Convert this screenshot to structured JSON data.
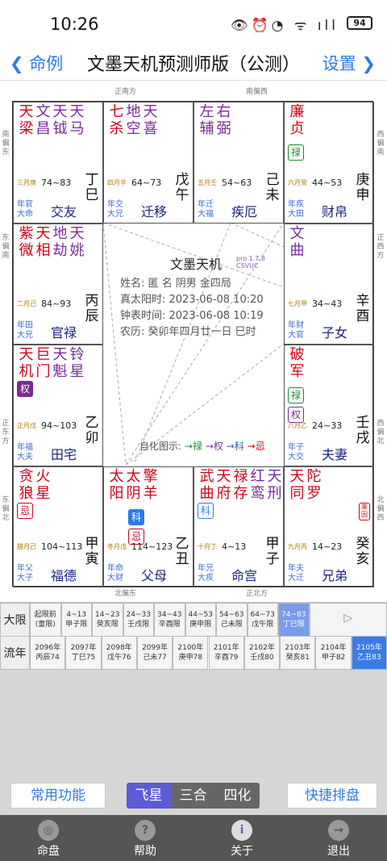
{
  "status": {
    "time": "10:26",
    "battery": "94"
  },
  "nav": {
    "back": "命例",
    "title": "文墨天机预测师版（公测）",
    "settings": "设置"
  },
  "directions": {
    "top_left": "正南方",
    "top_right": "南偏西",
    "left_top": "南偏东",
    "left_mid": "东偏南",
    "left_low": "正东方",
    "left_bottom": "东偏北",
    "right_top": "西偏南",
    "right_mid": "正西方",
    "right_low": "西偏北",
    "right_bottom": "北偏西",
    "bottom_left": "北偏东",
    "bottom_right": "正北方"
  },
  "palaces": [
    {
      "id": "si",
      "stars": [
        "天梁",
        "文昌",
        "天钺",
        "天马"
      ],
      "colors": [
        "red",
        "purple",
        "purple",
        "purple"
      ],
      "sihua": "",
      "changsheng": "三月庚",
      "age": "74~83",
      "ganzhi": "丁巳",
      "liunian": "年官",
      "daxian": "大命",
      "name": "交友"
    },
    {
      "id": "wu",
      "stars": [
        "七杀",
        "地空",
        "天喜"
      ],
      "colors": [
        "red",
        "purple",
        "purple"
      ],
      "sihua": "",
      "changsheng": "四月辛",
      "age": "64~73",
      "ganzhi": "戊午",
      "liunian": "年交",
      "daxian": "大兄",
      "name": "迁移"
    },
    {
      "id": "wei",
      "stars": [
        "左辅",
        "右弼"
      ],
      "colors": [
        "purple",
        "purple"
      ],
      "sihua": "",
      "changsheng": "五月壬",
      "age": "54~63",
      "ganzhi": "己未",
      "liunian": "年迁",
      "daxian": "大福",
      "name": "疾厄"
    },
    {
      "id": "shen",
      "stars": [
        "廉贞"
      ],
      "colors": [
        "red"
      ],
      "sihua": "禄",
      "changsheng": "六月癸",
      "age": "44~53",
      "ganzhi": "庚申",
      "liunian": "年疾",
      "daxian": "大田",
      "name": "财帛"
    },
    {
      "id": "chen",
      "stars": [
        "紫微",
        "天相",
        "地劫",
        "天姚"
      ],
      "colors": [
        "red",
        "red",
        "purple",
        "purple"
      ],
      "sihua": "",
      "changsheng": "二月己",
      "age": "84~93",
      "ganzhi": "丙辰",
      "liunian": "年田",
      "daxian": "大兄",
      "name": "官禄"
    },
    {
      "id": "you",
      "stars": [
        "文曲"
      ],
      "colors": [
        "purple"
      ],
      "sihua": "",
      "changsheng": "七月甲",
      "age": "34~43",
      "ganzhi": "辛酉",
      "liunian": "年财",
      "daxian": "大官",
      "name": "子女"
    },
    {
      "id": "mao",
      "stars": [
        "天机",
        "巨门",
        "天魁",
        "铃星"
      ],
      "colors": [
        "red",
        "red",
        "purple",
        "purple"
      ],
      "sihua": "权",
      "changsheng": "正月戊",
      "age": "94~103",
      "ganzhi": "乙卯",
      "liunian": "年福",
      "daxian": "大夫",
      "name": "田宅"
    },
    {
      "id": "xu",
      "stars": [
        "破军"
      ],
      "colors": [
        "red"
      ],
      "sihua": "禄权",
      "changsheng": "八月乙",
      "age": "24~33",
      "ganzhi": "壬戌",
      "liunian": "年子",
      "daxian": "大交",
      "name": "夫妻"
    },
    {
      "id": "yin",
      "stars": [
        "贪狼",
        "火星"
      ],
      "colors": [
        "red",
        "red"
      ],
      "sihua": "忌",
      "changsheng": "腊月己",
      "age": "104~113",
      "ganzhi": "甲寅",
      "liunian": "年父",
      "daxian": "大子",
      "name": "福德"
    },
    {
      "id": "chou",
      "stars": [
        "太阳",
        "太阴",
        "擎羊"
      ],
      "colors": [
        "red",
        "red",
        "red"
      ],
      "sihua": "科忌",
      "changsheng": "冬月戊",
      "age": "114~123",
      "ganzhi": "乙丑",
      "liunian": "年命",
      "daxian": "大财",
      "name": "父母"
    },
    {
      "id": "zi",
      "stars": [
        "武曲",
        "天府",
        "禄存",
        "红鸾",
        "天刑"
      ],
      "colors": [
        "red",
        "red",
        "red",
        "purple",
        "purple"
      ],
      "sihua": "科",
      "changsheng": "十月丁",
      "age": "4~13",
      "ganzhi": "甲子",
      "liunian": "年兄",
      "daxian": "大疾",
      "name": "命宫"
    },
    {
      "id": "hai",
      "stars": [
        "天同",
        "陀罗"
      ],
      "colors": [
        "red",
        "red"
      ],
      "sihua": "来因",
      "changsheng": "九月丙",
      "age": "14~23",
      "ganzhi": "癸亥",
      "liunian": "年夫",
      "daxian": "大迁",
      "name": "兄弟"
    }
  ],
  "center": {
    "title": "文墨天机",
    "version": "pro 1.7.8",
    "version_code": "C5VUC",
    "name_line": "姓名: 匿 名          阴男 金四局",
    "solar_line": "真太阳时: 2023-06-08 10:20",
    "clock_line": "钟表时间: 2023-06-08 10:19",
    "lunar_line": "农历: 癸卯年四月廿一日 巳时",
    "legend_label": "自化图示:",
    "legend_items": [
      "→禄",
      "→权",
      "→科",
      "→忌"
    ]
  },
  "daxian_label": "大限",
  "daxian": [
    {
      "top": "起限前",
      "bot": "(童限)"
    },
    {
      "top": "4~13",
      "bot": "甲子限"
    },
    {
      "top": "14~23",
      "bot": "癸亥限"
    },
    {
      "top": "24~33",
      "bot": "壬戌限"
    },
    {
      "top": "34~43",
      "bot": "辛酉限"
    },
    {
      "top": "44~53",
      "bot": "庚申限"
    },
    {
      "top": "54~63",
      "bot": "己未限"
    },
    {
      "top": "64~73",
      "bot": "戊午限"
    },
    {
      "top": "74~83",
      "bot": "丁巳限"
    }
  ],
  "daxian_more": "▷",
  "liunian_label": "流年",
  "liunian": [
    {
      "top": "2096年",
      "bot": "丙辰74"
    },
    {
      "top": "2097年",
      "bot": "丁巳75"
    },
    {
      "top": "2098年",
      "bot": "戊午76"
    },
    {
      "top": "2099年",
      "bot": "己未77"
    },
    {
      "top": "2100年",
      "bot": "庚申78"
    },
    {
      "top": "2101年",
      "bot": "辛酉79"
    },
    {
      "top": "2102年",
      "bot": "壬戌80"
    },
    {
      "top": "2103年",
      "bot": "癸亥81"
    },
    {
      "top": "2104年",
      "bot": "甲子82"
    },
    {
      "top": "2105年",
      "bot": "乙丑83"
    }
  ],
  "buttons": {
    "func": "常用功能",
    "quick": "快捷排盘"
  },
  "segments": [
    "飞星",
    "三合",
    "四化"
  ],
  "bottom_nav": [
    {
      "label": "命盘",
      "icon": "◎"
    },
    {
      "label": "帮助",
      "icon": "?"
    },
    {
      "label": "关于",
      "icon": "i"
    },
    {
      "label": "退出",
      "icon": "→"
    }
  ],
  "colors": {
    "accent": "#2c7be5",
    "selected": "#5b5bd6",
    "lu": "#1b8a2b",
    "quan": "#7b2a9a",
    "ke": "#2a7be5",
    "ji": "#d0021b"
  }
}
